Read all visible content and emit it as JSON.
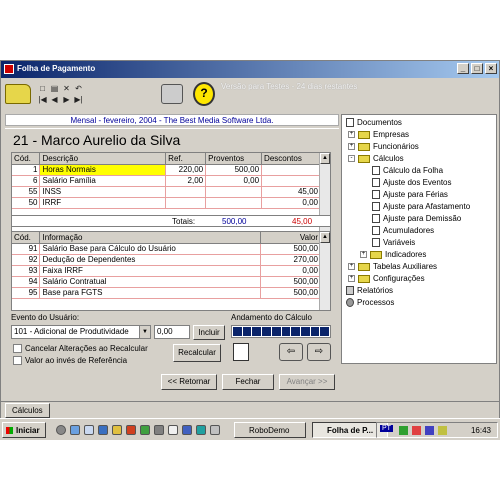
{
  "window": {
    "title": "Folha de Pagamento"
  },
  "header": {
    "version_text": "Versão para Testes - 24 dias restantes"
  },
  "company_line": "Mensal - fevereiro, 2004 - The Best Media Software Ltda.",
  "employee": "21 - Marco Aurelio da Silva",
  "calc_table": {
    "columns": [
      "Cód.",
      "Descrição",
      "Ref.",
      "Proventos",
      "Descontos"
    ],
    "rows": [
      {
        "cod": "1",
        "desc": "Horas Normais",
        "ref": "220,00",
        "prov": "500,00",
        "desc_val": ""
      },
      {
        "cod": "6",
        "desc": "Salário Família",
        "ref": "2,00",
        "prov": "0,00",
        "desc_val": ""
      },
      {
        "cod": "55",
        "desc": "INSS",
        "ref": "",
        "prov": "",
        "desc_val": "45,00"
      },
      {
        "cod": "50",
        "desc": "IRRF",
        "ref": "",
        "prov": "",
        "desc_val": "0,00"
      }
    ],
    "totals_label": "Totais:",
    "totals_prov": "500,00",
    "totals_desc": "45,00"
  },
  "info_table": {
    "columns": [
      "Cód.",
      "Informação",
      "Valor"
    ],
    "rows": [
      {
        "cod": "91",
        "info": "Salário Base para Cálculo do Usuário",
        "valor": "500,00"
      },
      {
        "cod": "92",
        "info": "Dedução de Dependentes",
        "valor": "270,00"
      },
      {
        "cod": "93",
        "info": "Faixa IRRF",
        "valor": "0,00"
      },
      {
        "cod": "94",
        "info": "Salário Contratual",
        "valor": "500,00"
      },
      {
        "cod": "95",
        "info": "Base para FGTS",
        "valor": "500,00"
      }
    ]
  },
  "event": {
    "label": "Evento do Usuário:",
    "selected": "101 - Adicional de Produtividade",
    "value": "0,00",
    "include_label": "Incluir",
    "progress_label": "Andamento do Cálculo",
    "progress": 1.0,
    "chk_cancel": "Cancelar Alterações ao Recalcular",
    "chk_ref": "Valor ao invés de Referência",
    "recalc_label": "Recalcular"
  },
  "nav": {
    "back": "<< Retornar",
    "close": "Fechar",
    "next": "Avançar >>"
  },
  "tree": {
    "root": "Documentos",
    "items": [
      {
        "label": "Empresas",
        "level": 1,
        "icon": "folder-icon",
        "expand": "+"
      },
      {
        "label": "Funcionários",
        "level": 1,
        "icon": "folder-icon",
        "expand": "+"
      },
      {
        "label": "Cálculos",
        "level": 1,
        "icon": "folder-icon",
        "expand": "-"
      },
      {
        "label": "Cálculo da Folha",
        "level": 2,
        "icon": "document-icon",
        "expand": ""
      },
      {
        "label": "Ajuste dos Eventos",
        "level": 2,
        "icon": "document-icon",
        "expand": ""
      },
      {
        "label": "Ajuste para Férias",
        "level": 2,
        "icon": "document-icon",
        "expand": ""
      },
      {
        "label": "Ajuste para Afastamento",
        "level": 2,
        "icon": "document-icon",
        "expand": ""
      },
      {
        "label": "Ajuste para Demissão",
        "level": 2,
        "icon": "document-icon",
        "expand": ""
      },
      {
        "label": "Acumuladores",
        "level": 2,
        "icon": "document-icon",
        "expand": ""
      },
      {
        "label": "Variáveis",
        "level": 2,
        "icon": "document-icon",
        "expand": ""
      },
      {
        "label": "Indicadores",
        "level": 2,
        "icon": "folder-icon",
        "expand": "+"
      },
      {
        "label": "Tabelas Auxiliares",
        "level": 1,
        "icon": "folder-icon",
        "expand": "+"
      },
      {
        "label": "Configurações",
        "level": 1,
        "icon": "folder-icon",
        "expand": "+"
      },
      {
        "label": "Relatórios",
        "level": 0,
        "icon": "printer-icon",
        "expand": ""
      },
      {
        "label": "Processos",
        "level": 0,
        "icon": "gear-icon",
        "expand": ""
      }
    ]
  },
  "tab": "Cálculos",
  "taskbar": {
    "start": "Iniciar",
    "tasks": [
      "RoboDemo",
      "Folha de P..."
    ],
    "clock": "16:43",
    "tray_text": "PT"
  }
}
